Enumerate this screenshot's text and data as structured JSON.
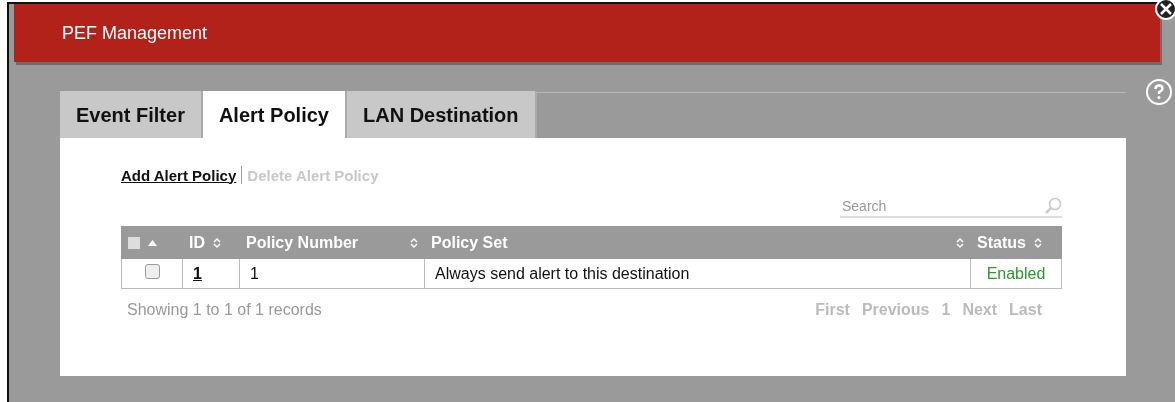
{
  "window": {
    "title": "PEF Management"
  },
  "tabs": [
    {
      "label": "Event Filter",
      "selected": false
    },
    {
      "label": "Alert Policy",
      "selected": true
    },
    {
      "label": "LAN Destination",
      "selected": false
    }
  ],
  "actions": [
    {
      "label": "Add Alert Policy",
      "disabled": false
    },
    {
      "label": "Delete Alert Policy",
      "disabled": true
    }
  ],
  "search": {
    "placeholder": "Search"
  },
  "table": {
    "select_all_checked": false,
    "columns": [
      {
        "label": "ID",
        "sortable": true
      },
      {
        "label": "Policy Number",
        "sortable": true
      },
      {
        "label": "Policy Set",
        "sortable": true
      },
      {
        "label": "Status",
        "sortable": true
      }
    ],
    "rows": [
      {
        "checked": false,
        "id": "1",
        "policy_number": "1",
        "policy_set": "Always send alert to this destination",
        "status": "Enabled",
        "enabled": true
      }
    ]
  },
  "footer": {
    "summary": "Showing 1 to 1 of 1 records",
    "pagination": [
      {
        "label": "First",
        "disabled": true
      },
      {
        "label": "Previous",
        "disabled": true
      },
      {
        "label": "1",
        "disabled": true
      },
      {
        "label": "Next",
        "disabled": true
      },
      {
        "label": "Last",
        "disabled": true
      }
    ]
  }
}
